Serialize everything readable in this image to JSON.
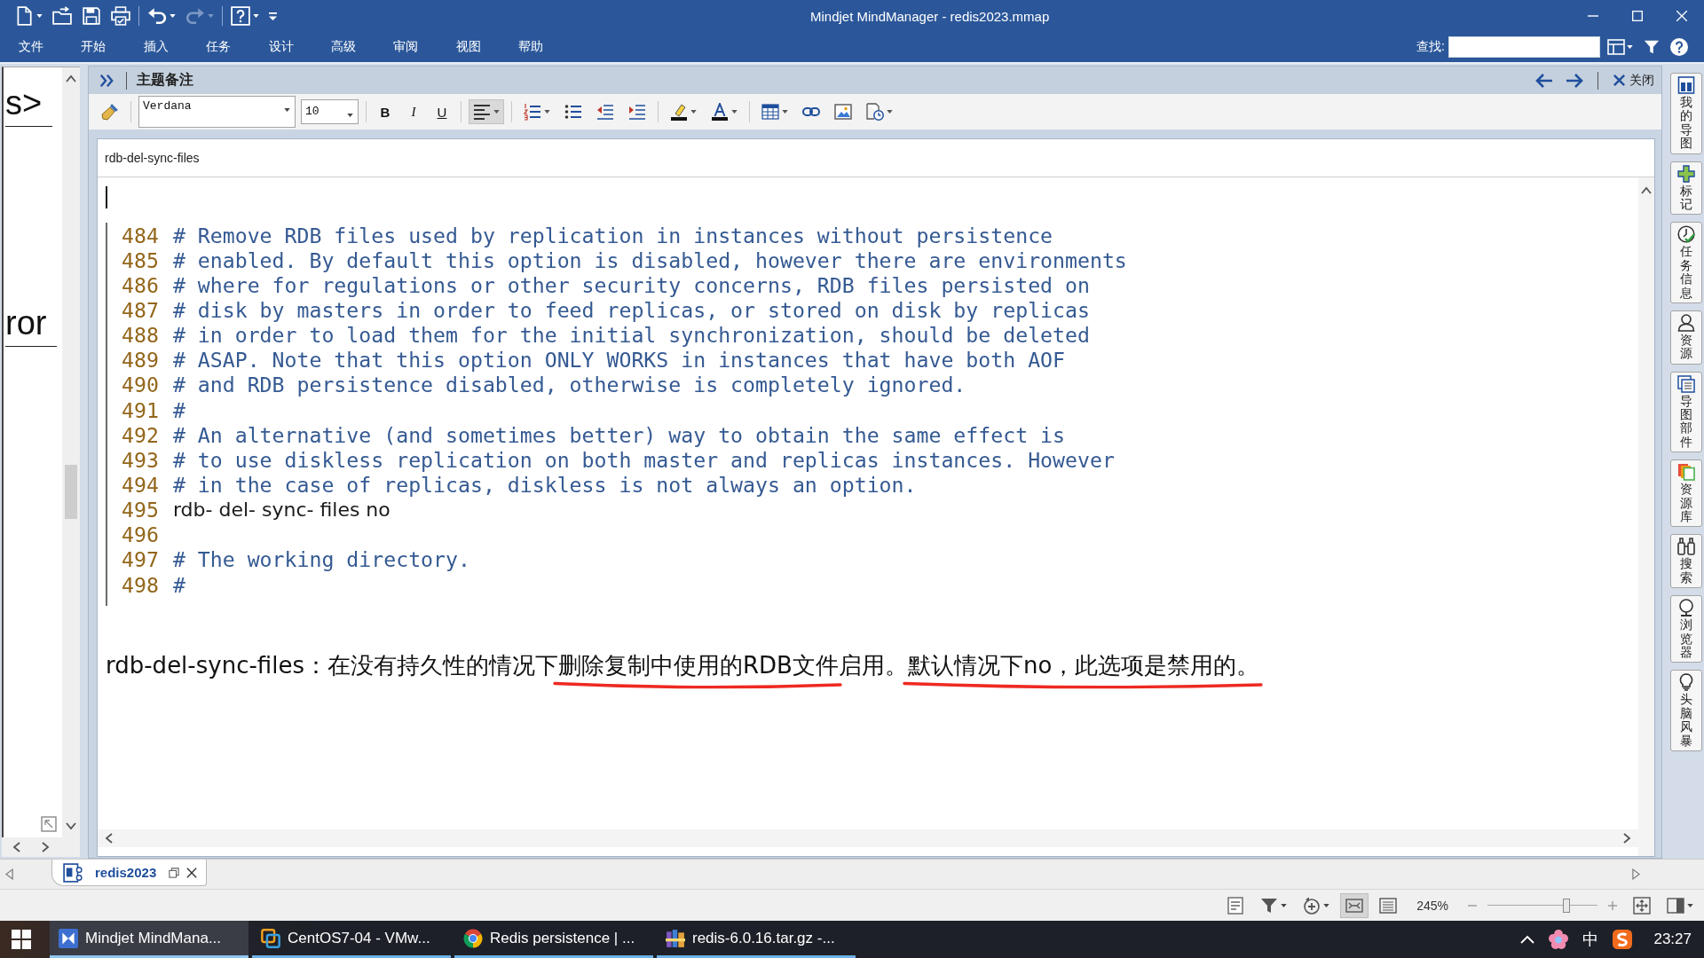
{
  "window": {
    "title": "Mindjet MindManager - redis2023.mmap"
  },
  "quick_access": [
    {
      "kind": "new",
      "menu": true,
      "disabled": false
    },
    {
      "kind": "open",
      "menu": false,
      "disabled": false
    },
    {
      "kind": "save",
      "menu": false,
      "disabled": false
    },
    {
      "kind": "print",
      "menu": false,
      "disabled": false
    },
    {
      "kind": "undo",
      "menu": true,
      "disabled": false
    },
    {
      "kind": "redo",
      "menu": true,
      "disabled": true
    },
    {
      "kind": "help",
      "menu": true,
      "disabled": false
    },
    {
      "kind": "customize",
      "menu": false,
      "disabled": false
    }
  ],
  "menu": [
    "文件",
    "开始",
    "插入",
    "任务",
    "设计",
    "高级",
    "审阅",
    "视图",
    "帮助"
  ],
  "search": {
    "label": "查找:"
  },
  "map_pane": {
    "topics": [
      "s>",
      "ror"
    ]
  },
  "notes_panel": {
    "title": "主题备注",
    "close_label": "关闭",
    "toolbar": [
      {
        "kind": "painter",
        "menu": false,
        "selected": false
      },
      {
        "kind": "font",
        "value": "Verdana",
        "menu": true
      },
      {
        "kind": "size",
        "value": "10",
        "menu": true
      },
      {
        "kind": "bold",
        "label": "B",
        "menu": false,
        "selected": false
      },
      {
        "kind": "italic",
        "label": "I",
        "menu": false,
        "selected": false
      },
      {
        "kind": "underline",
        "label": "U",
        "menu": false,
        "selected": false
      },
      {
        "kind": "align",
        "menu": true,
        "selected": true
      },
      {
        "kind": "numbering",
        "menu": true,
        "selected": false
      },
      {
        "kind": "bullets",
        "menu": false,
        "selected": false
      },
      {
        "kind": "outdent",
        "menu": false,
        "selected": false
      },
      {
        "kind": "indent",
        "menu": false,
        "selected": false
      },
      {
        "kind": "highlight",
        "menu": true,
        "selected": false
      },
      {
        "kind": "font-color",
        "menu": true,
        "selected": false
      },
      {
        "kind": "table",
        "menu": true,
        "selected": false
      },
      {
        "kind": "link",
        "menu": false,
        "selected": false
      },
      {
        "kind": "image",
        "menu": false,
        "selected": false
      },
      {
        "kind": "field",
        "menu": true,
        "selected": false
      }
    ],
    "topic_title": "rdb-del-sync-files",
    "caret": true,
    "code_lines": [
      {
        "number": "484",
        "kind": "comment",
        "text": "# Remove RDB files used by replication in instances without persistence"
      },
      {
        "number": "485",
        "kind": "comment",
        "text": "# enabled. By default this option is disabled, however there are environments"
      },
      {
        "number": "486",
        "kind": "comment",
        "text": "# where for regulations or other security concerns, RDB files persisted on"
      },
      {
        "number": "487",
        "kind": "comment",
        "text": "# disk by masters in order to feed replicas, or stored on disk by replicas"
      },
      {
        "number": "488",
        "kind": "comment",
        "text": "# in order to load them for the initial synchronization, should be deleted"
      },
      {
        "number": "489",
        "kind": "comment",
        "text": "# ASAP. Note that this option ONLY WORKS in instances that have both AOF"
      },
      {
        "number": "490",
        "kind": "comment",
        "text": "# and RDB persistence disabled, otherwise is completely ignored."
      },
      {
        "number": "491",
        "kind": "comment",
        "text": "#"
      },
      {
        "number": "492",
        "kind": "comment",
        "text": "# An alternative (and sometimes better) way to obtain the same effect is"
      },
      {
        "number": "493",
        "kind": "comment",
        "text": "# to use diskless replication on both master and replicas instances. However"
      },
      {
        "number": "494",
        "kind": "comment",
        "text": "# in the case of replicas, diskless is not always an option."
      },
      {
        "number": "495",
        "kind": "code",
        "text": "rdb- del- sync- files no"
      },
      {
        "number": "496"
      },
      {
        "number": "497",
        "kind": "comment",
        "text": "# The working directory."
      },
      {
        "number": "498",
        "kind": "comment",
        "text": "#"
      }
    ],
    "note": [
      {
        "text": "rdb-del-sync-files：在没有持久性的情况下",
        "underlined": false
      },
      {
        "text": "删除复制中使用的RDB文件",
        "underlined": true
      },
      {
        "text": "启用。",
        "underlined": false
      },
      {
        "text": "默认情况下no，此选项是禁用的。",
        "underlined": true
      }
    ]
  },
  "side_tabs": [
    {
      "label": "我的导图",
      "kind": "map"
    },
    {
      "label": "标记",
      "kind": "markers"
    },
    {
      "label": "任务信息",
      "kind": "task"
    },
    {
      "label": "资源",
      "kind": "resource"
    },
    {
      "label": "导图部件",
      "kind": "parts"
    },
    {
      "label": "资源库",
      "kind": "library"
    },
    {
      "label": "搜索",
      "kind": "search"
    },
    {
      "label": "浏览器",
      "kind": "browser"
    },
    {
      "label": "头脑风暴",
      "kind": "brainstorm"
    }
  ],
  "doc_tabs": [
    {
      "label": "redis2023",
      "selected": true
    }
  ],
  "status_bar": {
    "tools": [
      {
        "kind": "notes",
        "menu": false,
        "selected": false
      },
      {
        "kind": "filter",
        "menu": true,
        "selected": false
      },
      {
        "kind": "add",
        "menu": true,
        "selected": false
      },
      {
        "kind": "fit-map",
        "menu": false,
        "selected": true
      },
      {
        "kind": "outline",
        "menu": false,
        "selected": false
      }
    ],
    "zoom": "245%",
    "zoom_slider": {
      "level": 0.73
    },
    "view_tools": [
      {
        "kind": "fit-page",
        "menu": false
      },
      {
        "kind": "panel",
        "menu": true
      }
    ]
  },
  "taskbar": {
    "apps": [
      {
        "label": "Mindjet MindMana...",
        "kind": "mindmanager",
        "selected": true
      },
      {
        "label": "CentOS7-04 - VMw...",
        "kind": "vmware",
        "selected": false
      },
      {
        "label": "Redis persistence | ...",
        "kind": "browser",
        "selected": false
      },
      {
        "label": "redis-6.0.16.tar.gz -...",
        "kind": "archive",
        "selected": false
      }
    ],
    "ime": "中",
    "time": "23:27"
  }
}
